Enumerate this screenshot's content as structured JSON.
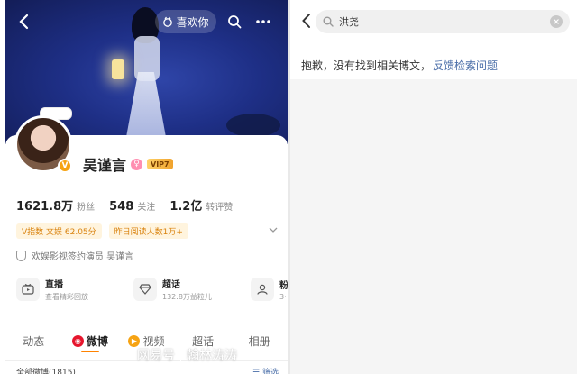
{
  "profile": {
    "like_label": "喜欢你",
    "name": "吴谨言",
    "vip_badge": "VIP7",
    "verify_badge": "V",
    "stats": [
      {
        "value": "1621.8万",
        "label": "粉丝"
      },
      {
        "value": "548",
        "label": "关注"
      },
      {
        "value": "1.2亿",
        "label": "转评赞"
      }
    ],
    "tags": [
      "V指数 文娱 62.05分",
      "昨日阅读人数1万+"
    ],
    "verification": "欢娱影视签约演员 吴谨言",
    "features": [
      {
        "title": "直播",
        "sub": "查看精彩回放"
      },
      {
        "title": "超话",
        "sub": "132.8万益粒儿"
      },
      {
        "title": "粉",
        "sub": "3·"
      }
    ],
    "tabs": [
      "动态",
      "微博",
      "视频",
      "超话",
      "相册"
    ],
    "active_tab": "微博",
    "all_posts": "全部微博(1815)",
    "filter_label": "筛选"
  },
  "search": {
    "query": "洪尧",
    "no_result_text": "抱歉，没有找到相关博文，",
    "feedback_link": "反馈检索问题"
  },
  "watermark": {
    "site": "网易号",
    "author": "翰林涛涛"
  },
  "colors": {
    "accent": "#ff8200",
    "link": "#4a6ea8",
    "tag_bg": "#fff4de",
    "tag_text": "#d9820d",
    "hero_blue": "#1e2f86"
  }
}
